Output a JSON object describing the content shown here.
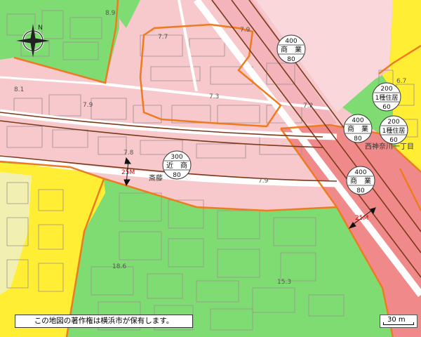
{
  "map": {
    "copyright": "この地図の著作権は横浜市が保有します。",
    "scale_label": "30 m",
    "compass": {
      "north_letter": "N",
      "icon": "compass-rose-icon"
    },
    "place_names": {
      "saito": "斎藤",
      "nishi_kamioka": "西神奈川一丁目"
    },
    "height_limits": {
      "left": "25M",
      "right": "25M"
    },
    "elevations": {
      "e89": "8.9",
      "e77": "7.7",
      "e79a": "7.9",
      "e81": "8.1",
      "e79b": "7.9",
      "e73": "7.3",
      "e72": "7.2",
      "e78": "7.8",
      "e79c": "7.9",
      "e67": "6.7",
      "e186": "18.6",
      "e153": "15.3"
    },
    "zones": [
      {
        "top": "400",
        "mid": "商　業",
        "bottom": "80"
      },
      {
        "top": "200",
        "mid": "1種住居",
        "bottom": "60"
      },
      {
        "top": "400",
        "mid": "商　業",
        "bottom": "80"
      },
      {
        "top": "200",
        "mid": "1種住居",
        "bottom": "60"
      },
      {
        "top": "300",
        "mid": "近　商",
        "bottom": "80"
      },
      {
        "top": "400",
        "mid": "商　業",
        "bottom": "80"
      }
    ],
    "colors": {
      "commercial": "#f08a8a",
      "neighborhood_commercial": "#f7c8cc",
      "residential_1": "#ffee33",
      "residential_light": "#f2f0b0",
      "low_rise": "#7fdc72",
      "zone_border": "#ee7b1f",
      "railway": "#7a3a1a"
    }
  }
}
